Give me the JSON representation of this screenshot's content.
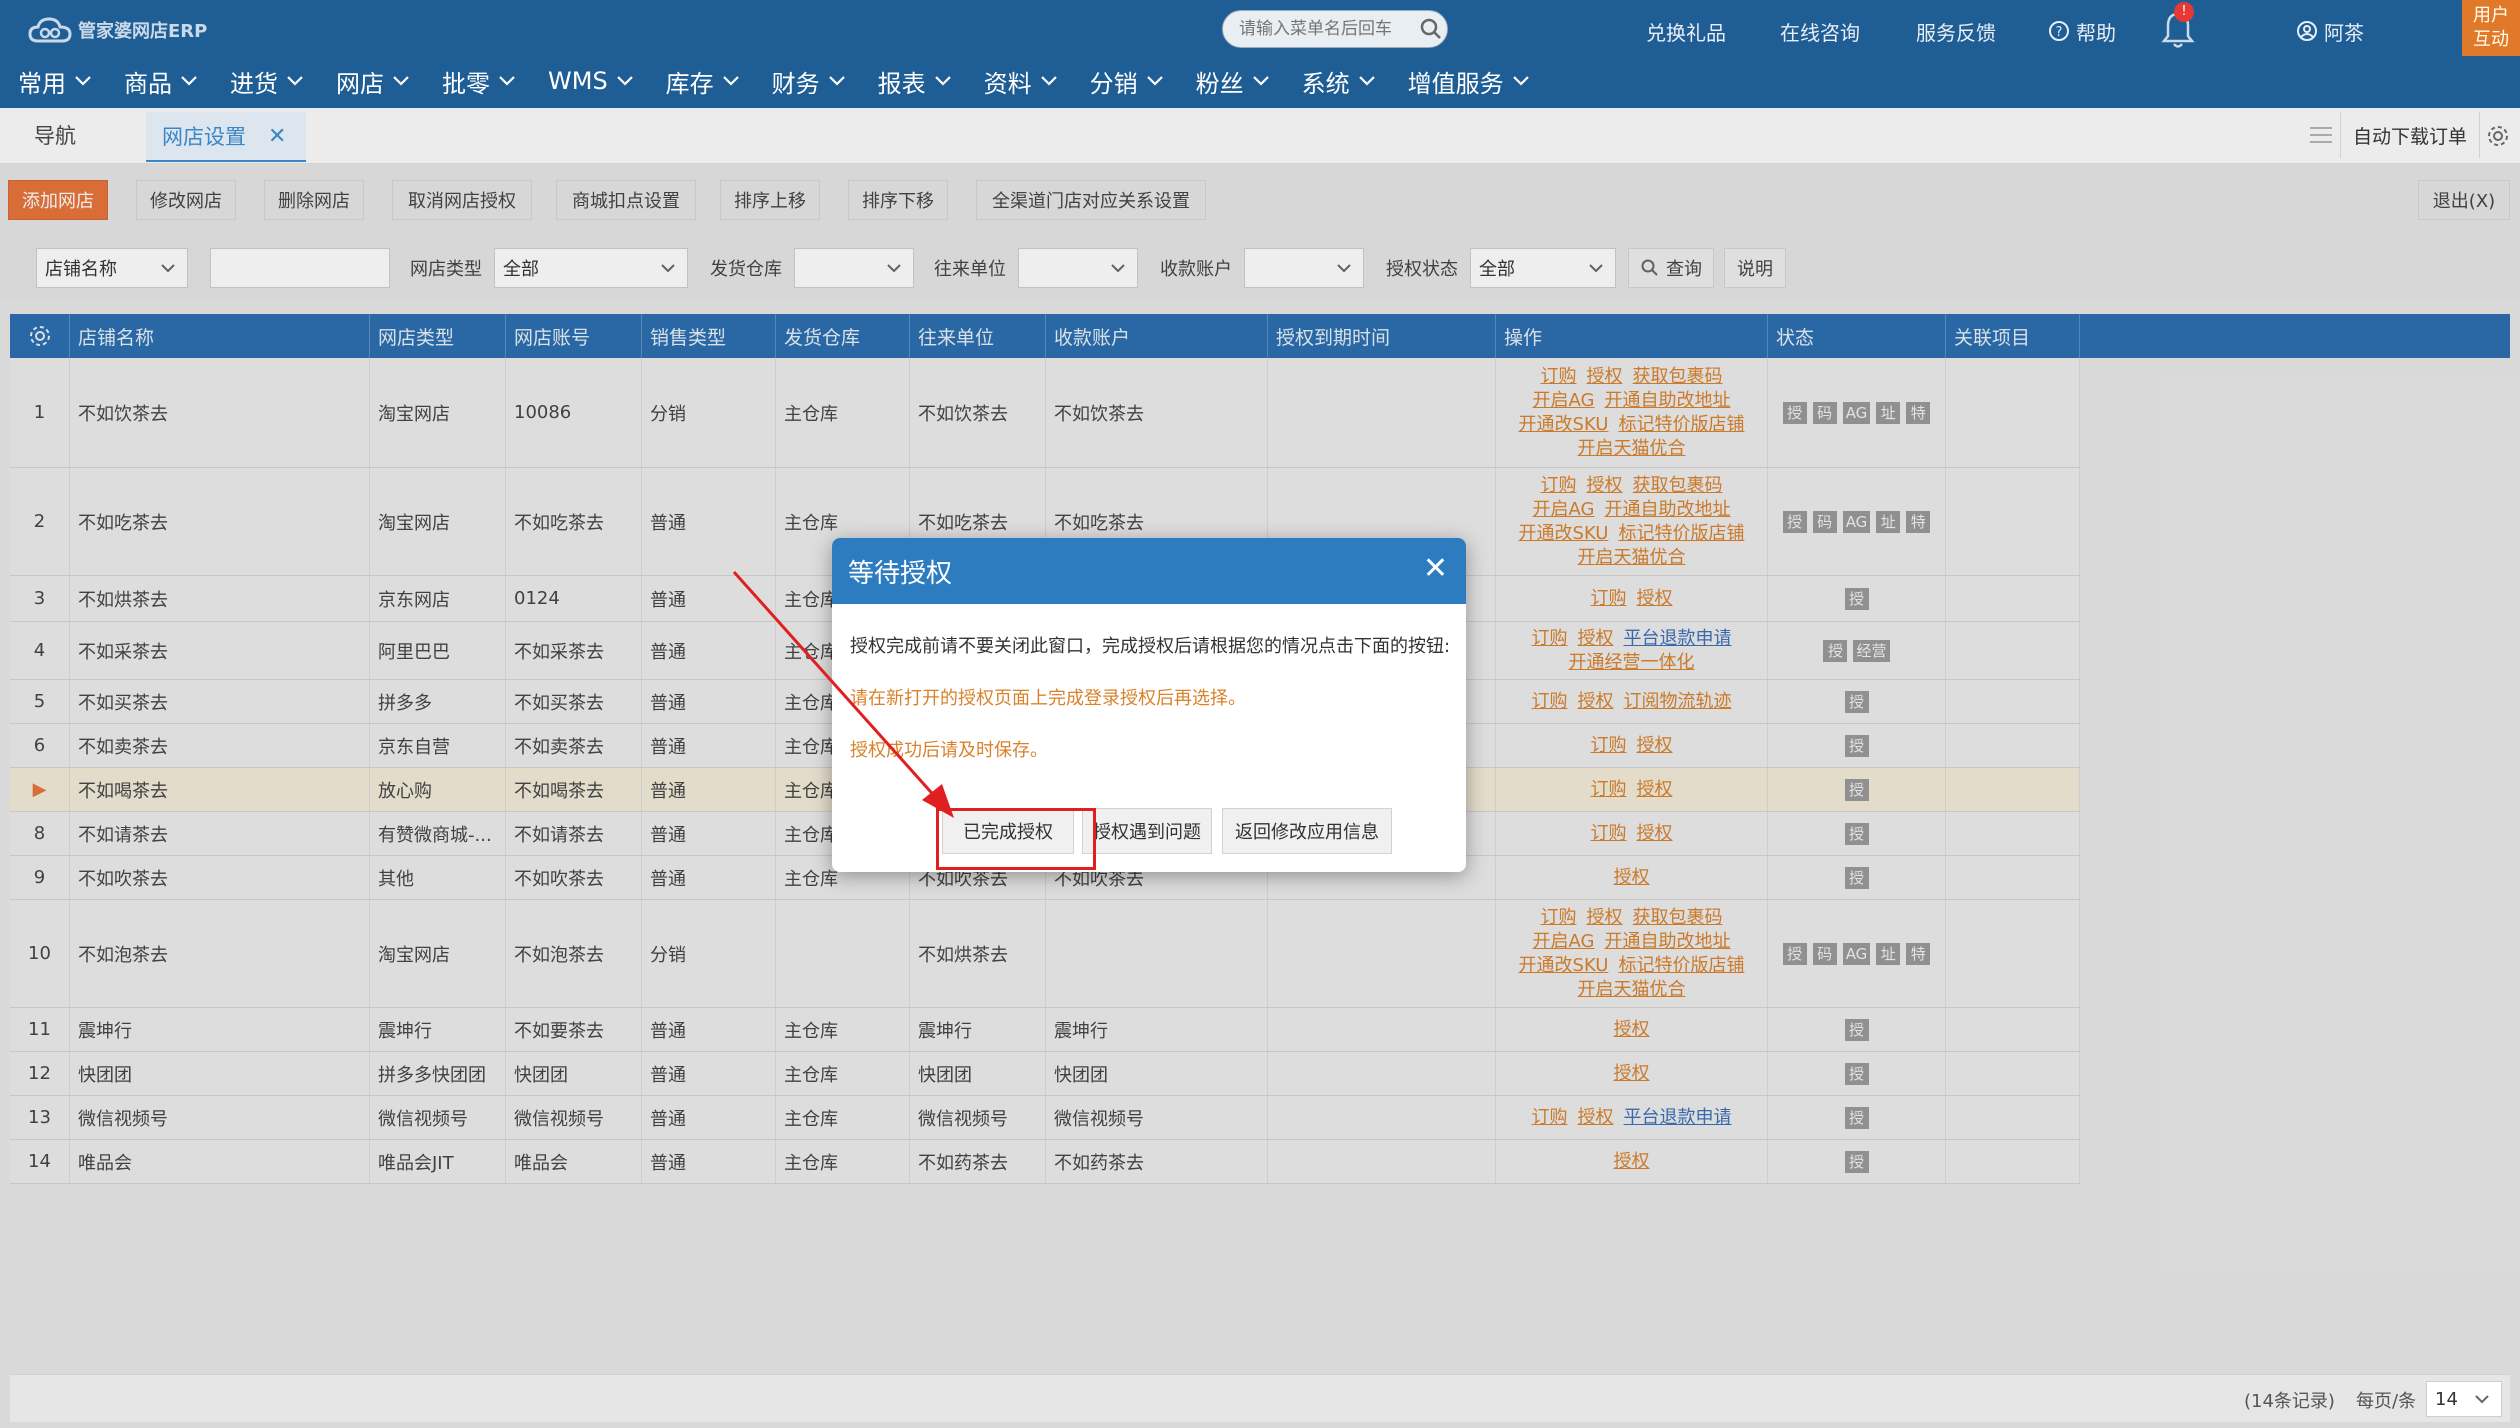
{
  "app": {
    "logo_text": "管家婆网店ERP"
  },
  "topbar": {
    "search_placeholder": "请输入菜单名后回车",
    "links": [
      "兑换礼品",
      "在线咨询",
      "服务反馈",
      "帮助"
    ],
    "notification_badge": "!",
    "user_name": "阿茶",
    "user_box": "用户互动"
  },
  "menu": [
    "常用",
    "商品",
    "进货",
    "网店",
    "批零",
    "WMS",
    "库存",
    "财务",
    "报表",
    "资料",
    "分销",
    "粉丝",
    "系统",
    "增值服务"
  ],
  "tabs": {
    "nav": "导航",
    "active": "网店设置",
    "close": "✕",
    "auto_download": "自动下载订单"
  },
  "toolbar": {
    "buttons": [
      "添加网店",
      "修改网店",
      "删除网店",
      "取消网店授权",
      "商城扣点设置",
      "排序上移",
      "排序下移",
      "全渠道门店对应关系设置"
    ],
    "exit": "退出(X)"
  },
  "filter": {
    "field_select": "店铺名称",
    "shop_type_label": "网店类型",
    "shop_type_value": "全部",
    "warehouse_label": "发货仓库",
    "contact_label": "往来单位",
    "account_label": "收款账户",
    "auth_label": "授权状态",
    "auth_value": "全部",
    "query": "查询",
    "help": "说明"
  },
  "table": {
    "columns": [
      "店铺名称",
      "网店类型",
      "网店账号",
      "销售类型",
      "发货仓库",
      "往来单位",
      "收款账户",
      "授权到期时间",
      "操作",
      "状态",
      "关联项目"
    ],
    "rows": [
      {
        "no": "1",
        "name": "不如饮茶去",
        "type": "淘宝网店",
        "account": "10086",
        "sale": "分销",
        "wh": "主仓库",
        "contact": "不如饮茶去",
        "pay": "不如饮茶去",
        "ops": [
          [
            "订购",
            "授权",
            "获取包裹码"
          ],
          [
            "开启AG",
            "开通自助改地址"
          ],
          [
            "开通改SKU",
            "标记特价版店铺"
          ],
          [
            "开启天猫优合"
          ]
        ],
        "badges": [
          "授",
          "码",
          "AG",
          "址",
          "特"
        ]
      },
      {
        "no": "2",
        "name": "不如吃茶去",
        "type": "淘宝网店",
        "account": "不如吃茶去",
        "sale": "普通",
        "wh": "主仓库",
        "contact": "不如吃茶去",
        "pay": "不如吃茶去",
        "ops": [
          [
            "订购",
            "授权",
            "获取包裹码"
          ],
          [
            "开启AG",
            "开通自助改地址"
          ],
          [
            "开通改SKU",
            "标记特价版店铺"
          ],
          [
            "开启天猫优合"
          ]
        ],
        "badges": [
          "授",
          "码",
          "AG",
          "址",
          "特"
        ]
      },
      {
        "no": "3",
        "name": "不如烘茶去",
        "type": "京东网店",
        "account": "0124",
        "sale": "普通",
        "wh": "主仓库",
        "contact": "",
        "pay": "",
        "ops": [
          [
            "订购",
            "授权"
          ]
        ],
        "badges": [
          "授"
        ]
      },
      {
        "no": "4",
        "name": "不如采茶去",
        "type": "阿里巴巴",
        "account": "不如采茶去",
        "sale": "普通",
        "wh": "主仓库",
        "contact": "",
        "pay": "",
        "ops": [
          [
            "订购",
            "授权",
            "平台退款申请"
          ],
          [
            "开通经营一体化"
          ]
        ],
        "badges": [
          "授",
          "经营"
        ]
      },
      {
        "no": "5",
        "name": "不如买茶去",
        "type": "拼多多",
        "account": "不如买茶去",
        "sale": "普通",
        "wh": "主仓库",
        "contact": "",
        "pay": "",
        "ops": [
          [
            "订购",
            "授权",
            "订阅物流轨迹"
          ]
        ],
        "badges": [
          "授"
        ]
      },
      {
        "no": "6",
        "name": "不如卖茶去",
        "type": "京东自营",
        "account": "不如卖茶去",
        "sale": "普通",
        "wh": "主仓库",
        "contact": "",
        "pay": "",
        "ops": [
          [
            "订购",
            "授权"
          ]
        ],
        "badges": [
          "授"
        ]
      },
      {
        "no": "▶",
        "name": "不如喝茶去",
        "type": "放心购",
        "account": "不如喝茶去",
        "sale": "普通",
        "wh": "主仓库",
        "contact": "",
        "pay": "",
        "ops": [
          [
            "订购",
            "授权"
          ]
        ],
        "badges": [
          "授"
        ],
        "selected": true
      },
      {
        "no": "8",
        "name": "不如请茶去",
        "type": "有赞微商城-...",
        "account": "不如请茶去",
        "sale": "普通",
        "wh": "主仓库",
        "contact": "",
        "pay": "",
        "ops": [
          [
            "订购",
            "授权"
          ]
        ],
        "badges": [
          "授"
        ]
      },
      {
        "no": "9",
        "name": "不如吹茶去",
        "type": "其他",
        "account": "不如吹茶去",
        "sale": "普通",
        "wh": "主仓库",
        "contact": "不如吹茶去",
        "pay": "不如吹茶去",
        "ops": [
          [
            "授权"
          ]
        ],
        "badges": [
          "授"
        ]
      },
      {
        "no": "10",
        "name": "不如泡茶去",
        "type": "淘宝网店",
        "account": "不如泡茶去",
        "sale": "分销",
        "wh": "",
        "contact": "不如烘茶去",
        "pay": "",
        "ops": [
          [
            "订购",
            "授权",
            "获取包裹码"
          ],
          [
            "开启AG",
            "开通自助改地址"
          ],
          [
            "开通改SKU",
            "标记特价版店铺"
          ],
          [
            "开启天猫优合"
          ]
        ],
        "badges": [
          "授",
          "码",
          "AG",
          "址",
          "特"
        ]
      },
      {
        "no": "11",
        "name": "震坤行",
        "type": "震坤行",
        "account": "不如要茶去",
        "sale": "普通",
        "wh": "主仓库",
        "contact": "震坤行",
        "pay": "震坤行",
        "ops": [
          [
            "授权"
          ]
        ],
        "badges": [
          "授"
        ]
      },
      {
        "no": "12",
        "name": "快团团",
        "type": "拼多多快团团",
        "account": "快团团",
        "sale": "普通",
        "wh": "主仓库",
        "contact": "快团团",
        "pay": "快团团",
        "ops": [
          [
            "授权"
          ]
        ],
        "badges": [
          "授"
        ]
      },
      {
        "no": "13",
        "name": "微信视频号",
        "type": "微信视频号",
        "account": "微信视频号",
        "sale": "普通",
        "wh": "主仓库",
        "contact": "微信视频号",
        "pay": "微信视频号",
        "ops": [
          [
            "订购",
            "授权",
            "平台退款申请"
          ]
        ],
        "badges": [
          "授"
        ]
      },
      {
        "no": "14",
        "name": "唯品会",
        "type": "唯品会JIT",
        "account": "唯品会",
        "sale": "普通",
        "wh": "主仓库",
        "contact": "不如药茶去",
        "pay": "不如药茶去",
        "ops": [
          [
            "授权"
          ]
        ],
        "badges": [
          "授"
        ]
      }
    ]
  },
  "footer": {
    "records": "(14条记录)",
    "per_page_label": "每页/条",
    "per_page": "14"
  },
  "dialog": {
    "title": "等待授权",
    "close": "✕",
    "line1": "授权完成前请不要关闭此窗口，完成授权后请根据您的情况点击下面的按钮:",
    "line2": "请在新打开的授权页面上完成登录授权后再选择。",
    "line3": "授权成功后请及时保存。",
    "btn_done": "已完成授权",
    "btn_problem": "授权遇到问题",
    "btn_back": "返回修改应用信息"
  },
  "colors": {
    "header_blue": "#1f5d95",
    "grid_header": "#2a6eb0",
    "accent_orange": "#e8733a",
    "link_orange": "#d9822b",
    "highlight_red": "#e02020"
  }
}
